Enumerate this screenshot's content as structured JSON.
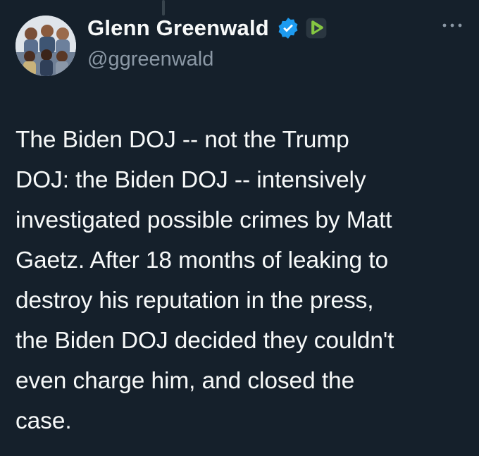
{
  "author": {
    "display_name": "Glenn Greenwald",
    "handle": "@ggreenwald",
    "verified": true,
    "avatar_icon": "group-photo-avatar",
    "badge_icons": [
      "verified-badge-icon",
      "rumble-badge-icon"
    ]
  },
  "tweet": {
    "text": "The Biden DOJ -- not the Trump\nDOJ: the Biden DOJ -- intensively\ninvestigated possible crimes by Matt\nGaetz. After 18 months of leaking to\ndestroy his reputation in the press,\nthe Biden DOJ decided they couldn't\neven charge him, and closed the\ncase."
  },
  "colors": {
    "background": "#15202b",
    "text_primary": "#f7f9f9",
    "text_secondary": "#8b98a5",
    "verified_blue": "#1d9bf0",
    "rumble_green": "#85c742"
  },
  "menu": {
    "more_icon": "more-horizontal-icon"
  }
}
